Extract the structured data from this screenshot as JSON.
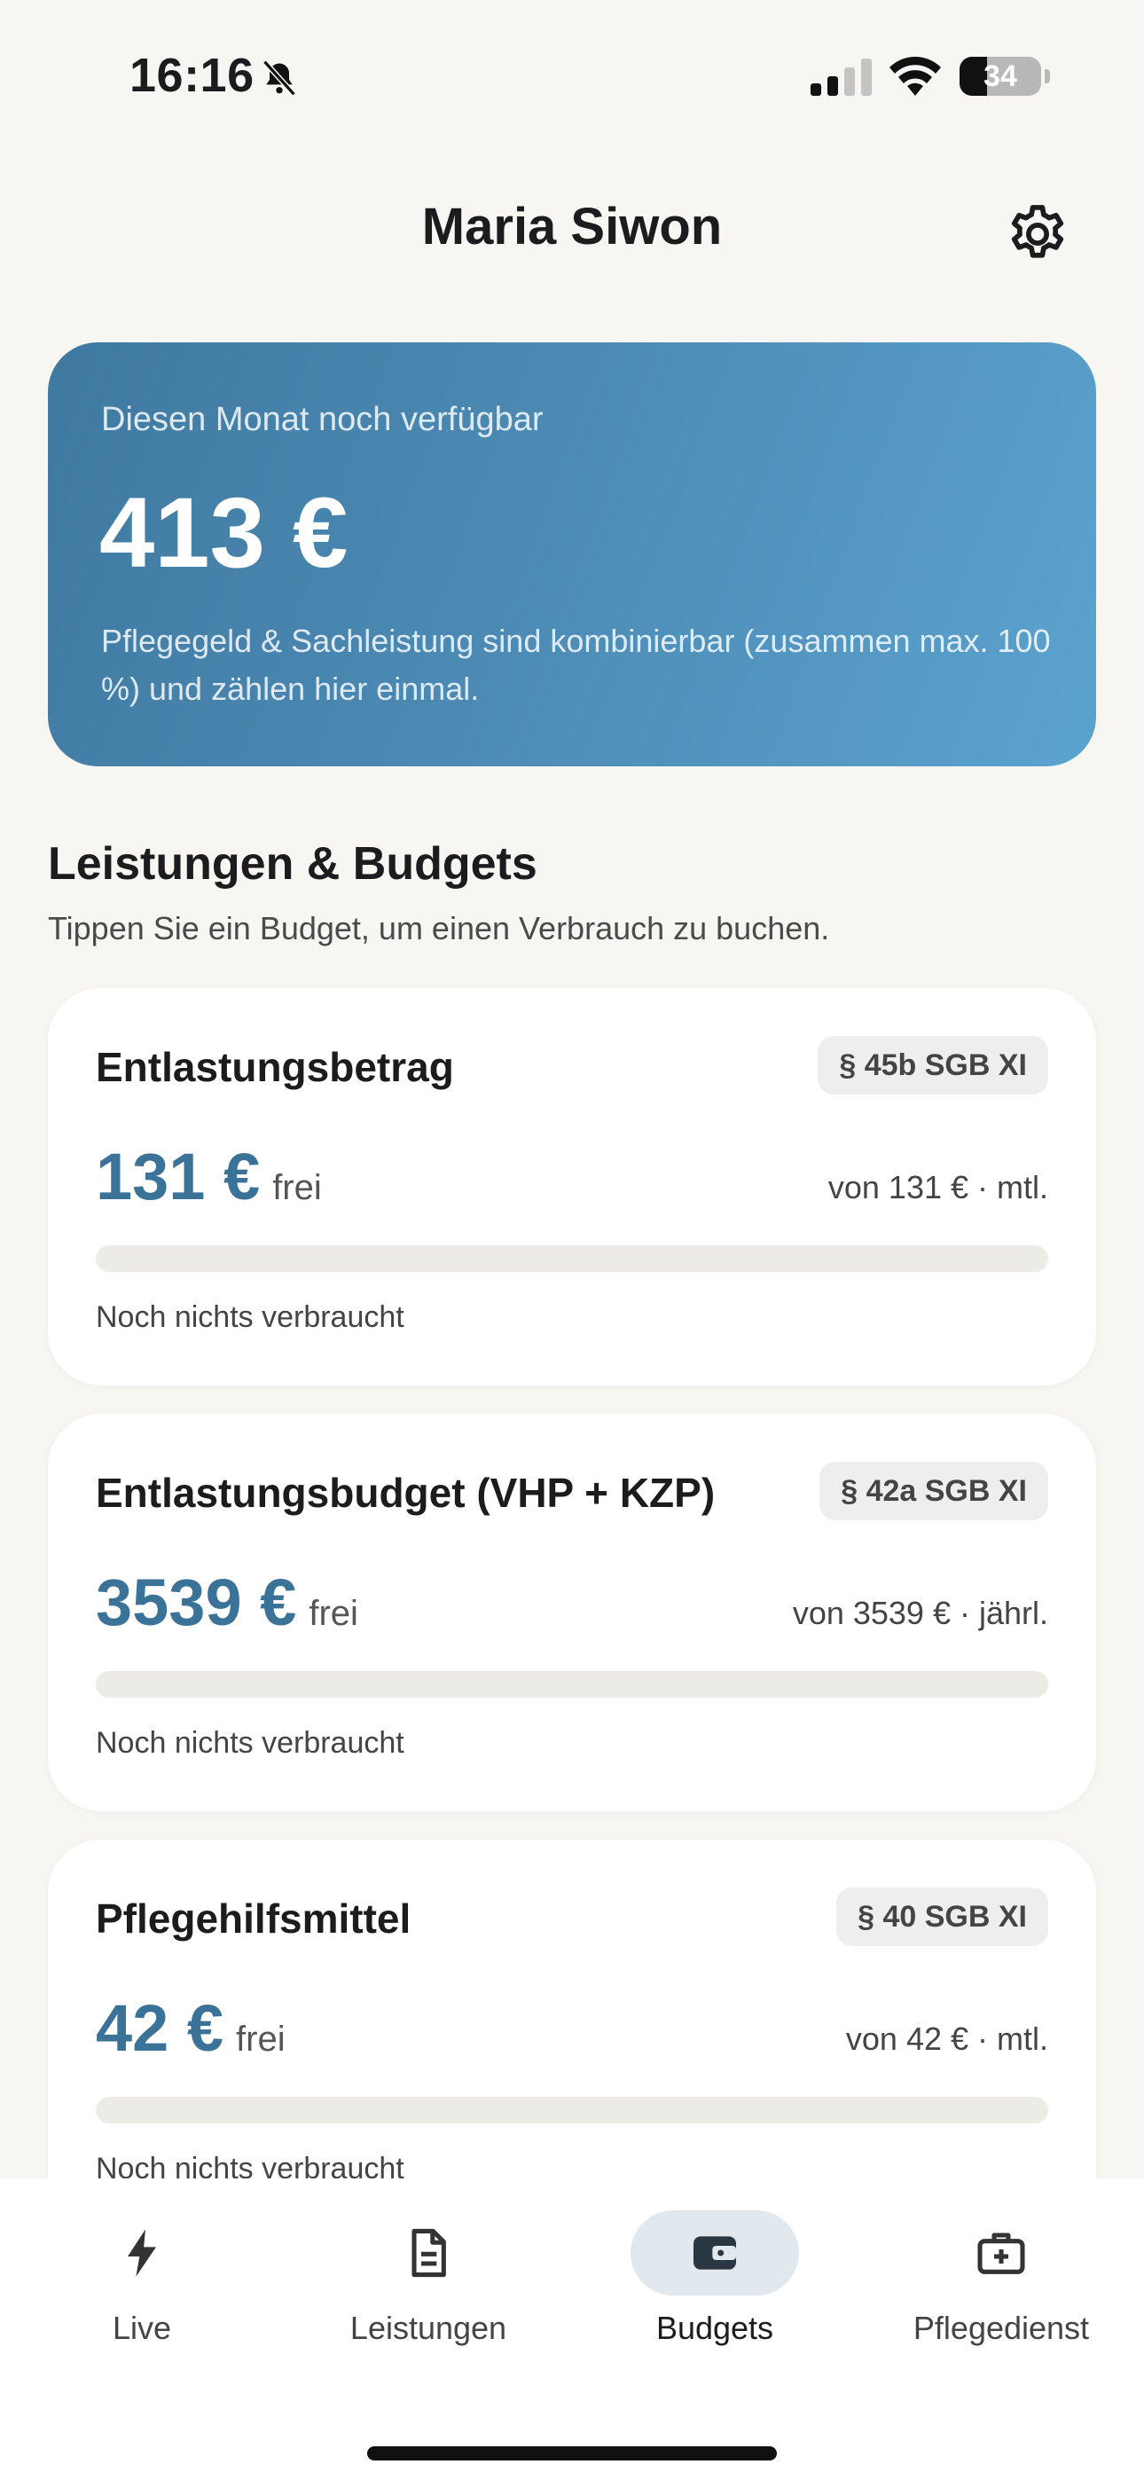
{
  "status_bar": {
    "time": "16:16",
    "battery": "34",
    "battery_level": 0.34
  },
  "header": {
    "title": "Maria Siwon"
  },
  "hero": {
    "label": "Diesen Monat noch verfügbar",
    "amount": "413 €",
    "note": "Pflegegeld & Sachleistung sind kombinierbar (zusammen max. 100 %) und zählen hier einmal."
  },
  "section": {
    "title": "Leistungen & Budgets",
    "subtitle": "Tippen Sie ein Budget, um einen Verbrauch zu buchen."
  },
  "budgets": [
    {
      "name": "Entlastungsbetrag",
      "badge": "§ 45b SGB XI",
      "amount": "131 €",
      "free": "frei",
      "of": "von 131 € · mtl.",
      "used_fraction": 0,
      "status": "Noch nichts verbraucht"
    },
    {
      "name": "Entlastungsbudget (VHP + KZP)",
      "badge": "§ 42a SGB XI",
      "amount": "3539 €",
      "free": "frei",
      "of": "von 3539 € · jährl.",
      "used_fraction": 0,
      "status": "Noch nichts verbraucht"
    },
    {
      "name": "Pflegehilfsmittel",
      "badge": "§ 40 SGB XI",
      "amount": "42 €",
      "free": "frei",
      "of": "von 42 € · mtl.",
      "used_fraction": 0,
      "status": "Noch nichts verbraucht"
    }
  ],
  "tabs": [
    {
      "label": "Live",
      "icon": "bolt-icon",
      "active": false
    },
    {
      "label": "Leistungen",
      "icon": "document-icon",
      "active": false
    },
    {
      "label": "Budgets",
      "icon": "wallet-icon",
      "active": true
    },
    {
      "label": "Pflegedienst",
      "icon": "medical-kit-icon",
      "active": false
    }
  ],
  "colors": {
    "accent": "#3b7398",
    "background": "#f7f6f3",
    "hero_start": "#3f79a0",
    "hero_end": "#5ba3cf"
  }
}
